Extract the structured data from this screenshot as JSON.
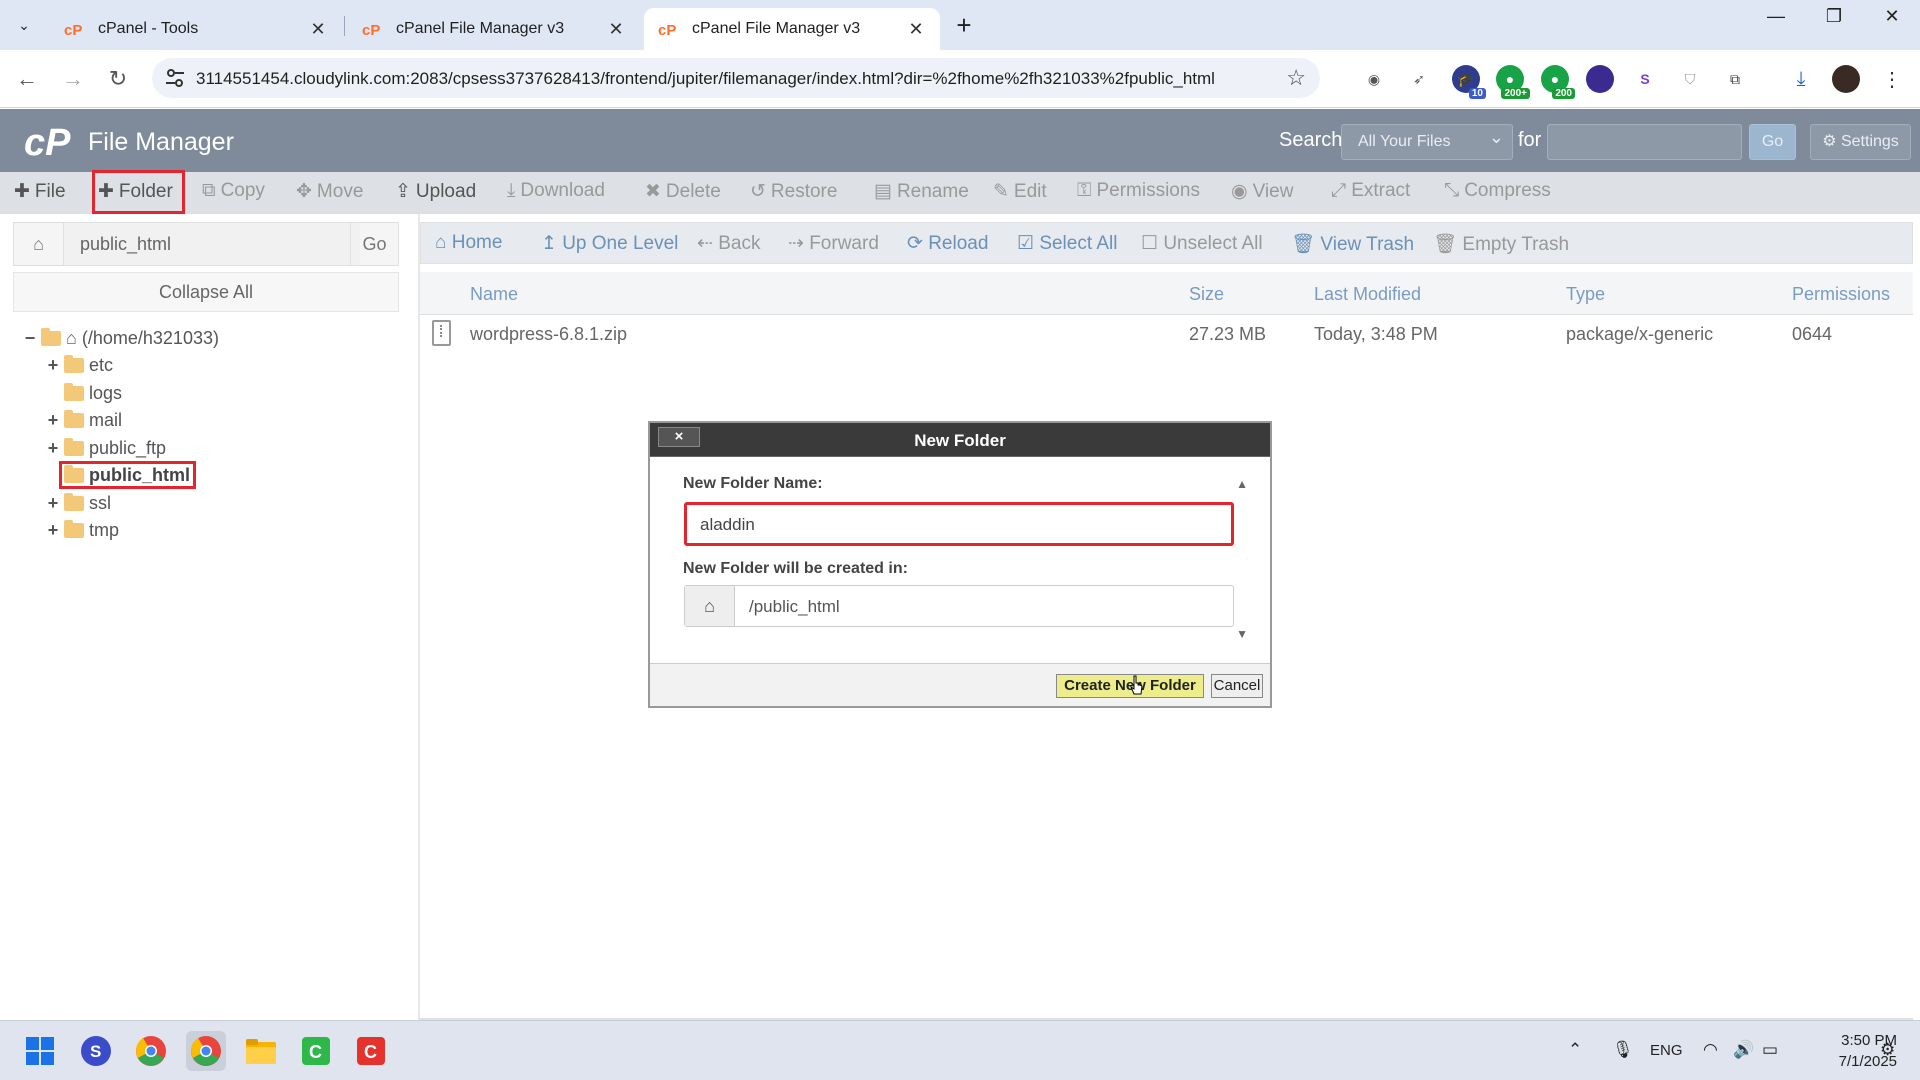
{
  "browser": {
    "tabs": [
      {
        "title": "cPanel - Tools",
        "active": false
      },
      {
        "title": "cPanel File Manager v3",
        "active": false
      },
      {
        "title": "cPanel File Manager v3",
        "active": true
      }
    ],
    "url": "3114551454.cloudylink.com:2083/cpsess3737628413/frontend/jupiter/filemanager/index.html?dir=%2fhome%2fh321033%2fpublic_html",
    "extensions": [
      {
        "icon": "camera-icon"
      },
      {
        "icon": "rocket-icon"
      },
      {
        "icon": "graduation-cap-icon",
        "badge": "10"
      },
      {
        "icon": "green-extension-icon",
        "badge": "200+"
      },
      {
        "icon": "green-extension-icon",
        "badge": "200"
      },
      {
        "icon": "purple-circle-icon"
      },
      {
        "icon": "shield-s-icon"
      },
      {
        "icon": "shield-icon"
      },
      {
        "icon": "puzzle-icon"
      },
      {
        "icon": "download-icon"
      },
      {
        "icon": "avatar-icon"
      },
      {
        "icon": "menu-icon"
      }
    ]
  },
  "cpanel": {
    "title": "File Manager",
    "search_label": "Search",
    "search_scope": "All Your Files",
    "for_label": "for",
    "search_value": "",
    "go_label": "Go",
    "settings_label": "Settings"
  },
  "toolbar": [
    {
      "label": "File",
      "icon": "plus-icon",
      "enabled": true
    },
    {
      "label": "Folder",
      "icon": "plus-icon",
      "enabled": true
    },
    {
      "label": "Copy",
      "icon": "copy-icon",
      "enabled": false
    },
    {
      "label": "Move",
      "icon": "move-icon",
      "enabled": false
    },
    {
      "label": "Upload",
      "icon": "upload-icon",
      "enabled": true
    },
    {
      "label": "Download",
      "icon": "download-icon",
      "enabled": false
    },
    {
      "label": "Delete",
      "icon": "delete-icon",
      "enabled": false
    },
    {
      "label": "Restore",
      "icon": "restore-icon",
      "enabled": false
    },
    {
      "label": "Rename",
      "icon": "rename-icon",
      "enabled": false
    },
    {
      "label": "Edit",
      "icon": "pencil-icon",
      "enabled": false
    },
    {
      "label": "Permissions",
      "icon": "key-icon",
      "enabled": false
    },
    {
      "label": "View",
      "icon": "eye-icon",
      "enabled": false
    },
    {
      "label": "Extract",
      "icon": "expand-icon",
      "enabled": false
    },
    {
      "label": "Compress",
      "icon": "compress-icon",
      "enabled": false
    }
  ],
  "left": {
    "path_value": "public_html",
    "go_label": "Go",
    "collapse_label": "Collapse All",
    "tree": [
      {
        "label": "(/home/h321033)",
        "expander": "−",
        "root": true
      },
      {
        "label": "etc",
        "expander": "+"
      },
      {
        "label": "logs",
        "expander": ""
      },
      {
        "label": "mail",
        "expander": "+"
      },
      {
        "label": "public_ftp",
        "expander": "+"
      },
      {
        "label": "public_html",
        "expander": "",
        "selected": true
      },
      {
        "label": "ssl",
        "expander": "+"
      },
      {
        "label": "tmp",
        "expander": "+"
      }
    ]
  },
  "right": {
    "nav": [
      {
        "label": "Home",
        "icon": "home-icon",
        "enabled": true
      },
      {
        "label": "Up One Level",
        "icon": "up-arrow-icon",
        "enabled": true
      },
      {
        "label": "Back",
        "icon": "back-arrow-icon",
        "enabled": false
      },
      {
        "label": "Forward",
        "icon": "forward-arrow-icon",
        "enabled": false
      },
      {
        "label": "Reload",
        "icon": "reload-icon",
        "enabled": true
      },
      {
        "label": "Select All",
        "icon": "checkbox-checked-icon",
        "enabled": true
      },
      {
        "label": "Unselect All",
        "icon": "checkbox-empty-icon",
        "enabled": false
      },
      {
        "label": "View Trash",
        "icon": "trash-icon",
        "enabled": true
      },
      {
        "label": "Empty Trash",
        "icon": "trash-icon",
        "enabled": false
      }
    ],
    "columns": [
      "Name",
      "Size",
      "Last Modified",
      "Type",
      "Permissions"
    ],
    "files": [
      {
        "name": "wordpress-6.8.1.zip",
        "size": "27.23 MB",
        "modified": "Today, 3:48 PM",
        "type": "package/x-generic",
        "perms": "0644"
      }
    ]
  },
  "modal": {
    "title": "New Folder",
    "close_label": "×",
    "name_label": "New Folder Name:",
    "name_value": "aladdin",
    "location_label": "New Folder will be created in:",
    "location_value": "/public_html",
    "create_label": "Create New Folder",
    "cancel_label": "Cancel"
  },
  "taskbar": {
    "apps": [
      "windows-start-icon",
      "s-app-icon",
      "chrome-icon",
      "chrome-profile-icon",
      "file-explorer-icon",
      "green-app-icon",
      "red-app-icon"
    ],
    "lang": "ENG",
    "time": "3:50 PM",
    "date": "7/1/2025"
  },
  "colors": {
    "cpanel_header": "#7f8b9b",
    "toolbar_bg": "#dde0e5",
    "highlight_red": "#e3262d",
    "link_blue": "#6b91b7",
    "folder_yellow": "#f3c879",
    "create_button": "#eded8c"
  }
}
